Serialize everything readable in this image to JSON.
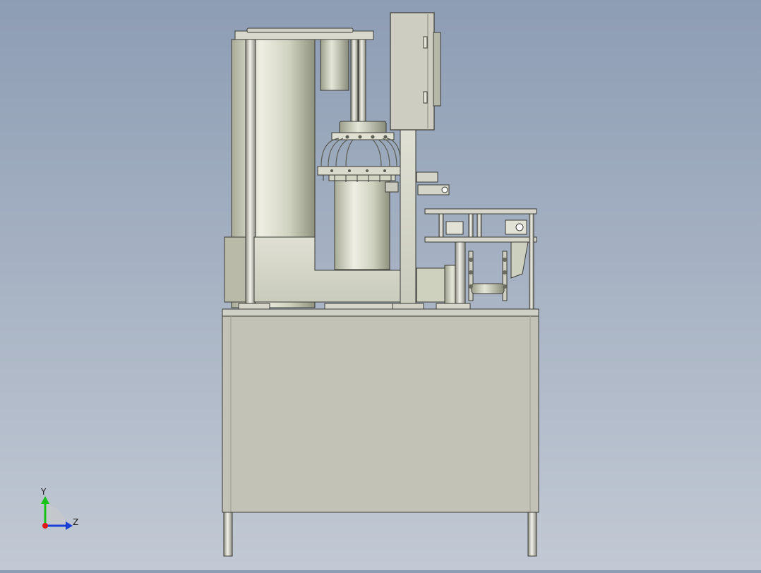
{
  "viewport": {
    "background_top": "#8d9db4",
    "background_bottom": "#c2c9d4"
  },
  "triad": {
    "y_label": "Y",
    "z_label": "Z",
    "y_color": "#19c219",
    "z_color": "#1a3fd6",
    "x_color": "#e01818"
  },
  "model": {
    "body_color": "#d6d8c6",
    "base_color": "#c2c2b6",
    "edge_color": "#3a3a36"
  }
}
